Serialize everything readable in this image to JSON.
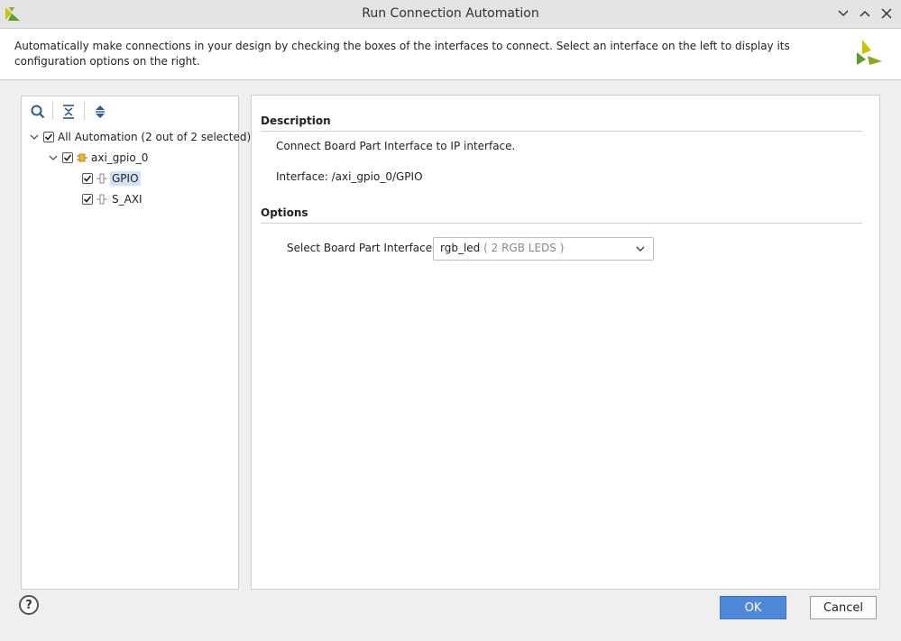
{
  "window": {
    "title": "Run Connection Automation"
  },
  "info": {
    "description": "Automatically make connections in your design by checking the boxes of the interfaces to connect. Select an interface on the left to display its configuration options on the right."
  },
  "tree": {
    "root_label": "All Automation (2 out of 2 selected)",
    "ip_label": "axi_gpio_0",
    "interfaces": [
      {
        "label": "GPIO",
        "checked": true,
        "selected": true
      },
      {
        "label": "S_AXI",
        "checked": true,
        "selected": false
      }
    ]
  },
  "details": {
    "description_title": "Description",
    "description_text": "Connect Board Part Interface to IP interface.",
    "interface_text": "Interface: /axi_gpio_0/GPIO",
    "options_title": "Options",
    "select_label": "Select Board Part Interface",
    "select_value": "rgb_led",
    "select_value_detail": "( 2 RGB LEDS )"
  },
  "footer": {
    "help_label": "?",
    "ok_label": "OK",
    "cancel_label": "Cancel"
  },
  "colors": {
    "accent": "#4f88d8",
    "selection": "#d3e1f5",
    "logo_yellow": "#c8c400",
    "logo_green": "#5e9a2e"
  }
}
